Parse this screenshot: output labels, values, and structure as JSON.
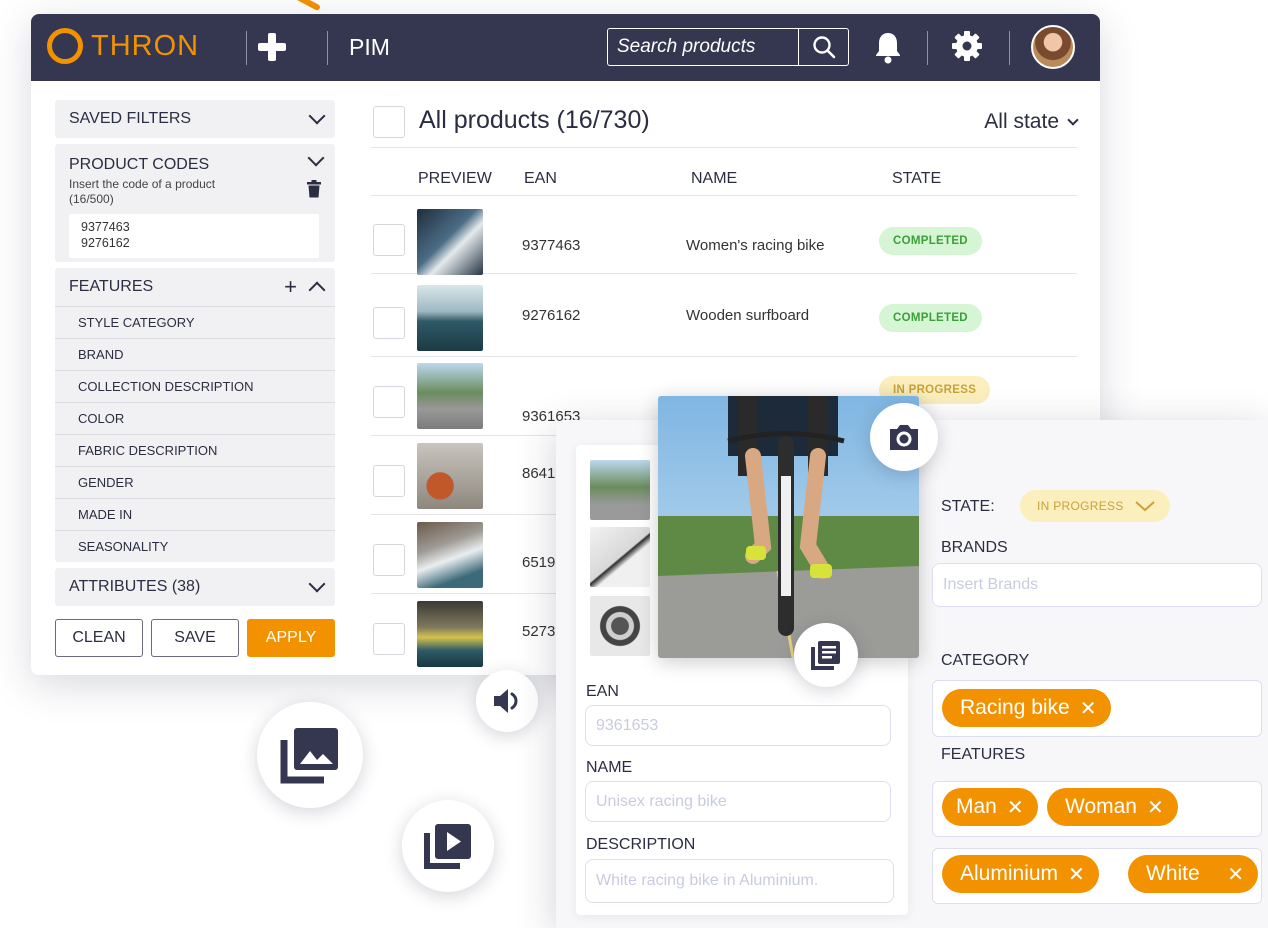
{
  "header": {
    "logo_text": "THRON",
    "section": "PIM",
    "search_placeholder": "Search products"
  },
  "sidebar": {
    "saved_filters": "SAVED FILTERS",
    "product_codes": {
      "title": "PRODUCT CODES",
      "hint": "Insert the code of a product (16/500)",
      "codes": [
        "9377463",
        "9276162"
      ]
    },
    "features": {
      "title": "FEATURES",
      "items": [
        "STYLE CATEGORY",
        "BRAND",
        "COLLECTION DESCRIPTION",
        "COLOR",
        "FABRIC DESCRIPTION",
        "GENDER",
        "MADE IN",
        "SEASONALITY"
      ]
    },
    "attributes": "ATTRIBUTES (38)",
    "buttons": {
      "clean": "CLEAN",
      "save": "SAVE",
      "apply": "APPLY"
    }
  },
  "products": {
    "title": "All products (16/730)",
    "state_filter": "All state",
    "columns": {
      "preview": "PREVIEW",
      "ean": "EAN",
      "name": "NAME",
      "state": "STATE"
    },
    "rows": [
      {
        "ean": "9377463",
        "name": "Women's racing bike",
        "state": "COMPLETED"
      },
      {
        "ean": "9276162",
        "name": "Wooden surfboard",
        "state": "COMPLETED"
      },
      {
        "ean": "9361653",
        "name": "",
        "state": "IN PROGRESS"
      },
      {
        "ean": "8641",
        "name": "",
        "state": ""
      },
      {
        "ean": "6519",
        "name": "",
        "state": ""
      },
      {
        "ean": "5273",
        "name": "",
        "state": ""
      }
    ]
  },
  "detail": {
    "ean_label": "EAN",
    "ean_value": "9361653",
    "name_label": "NAME",
    "name_value": "Unisex racing bike",
    "description_label": "DESCRIPTION",
    "description_value": "White racing bike in Aluminium.",
    "state_label": "STATE:",
    "state_value": "IN PROGRESS",
    "brands_label": "BRANDS",
    "brands_placeholder": "Insert Brands",
    "category_label": "CATEGORY",
    "category_tags": [
      "Racing bike"
    ],
    "features_label": "FEATURES",
    "feature_tags": [
      "Man",
      "Woman",
      "Aluminium",
      "White"
    ]
  },
  "colors": {
    "accent": "#f39200",
    "topbar": "#34374f",
    "completed_bg": "#d6f5d4",
    "completed_text": "#3c9f3a",
    "progress_bg": "#fbefbe",
    "progress_text": "#c9a23b"
  },
  "icons": [
    "plus-icon",
    "search-icon",
    "bell-icon",
    "gear-icon",
    "trash-icon",
    "camera-icon",
    "document-icon",
    "speaker-icon",
    "gallery-icon",
    "video-icon"
  ]
}
